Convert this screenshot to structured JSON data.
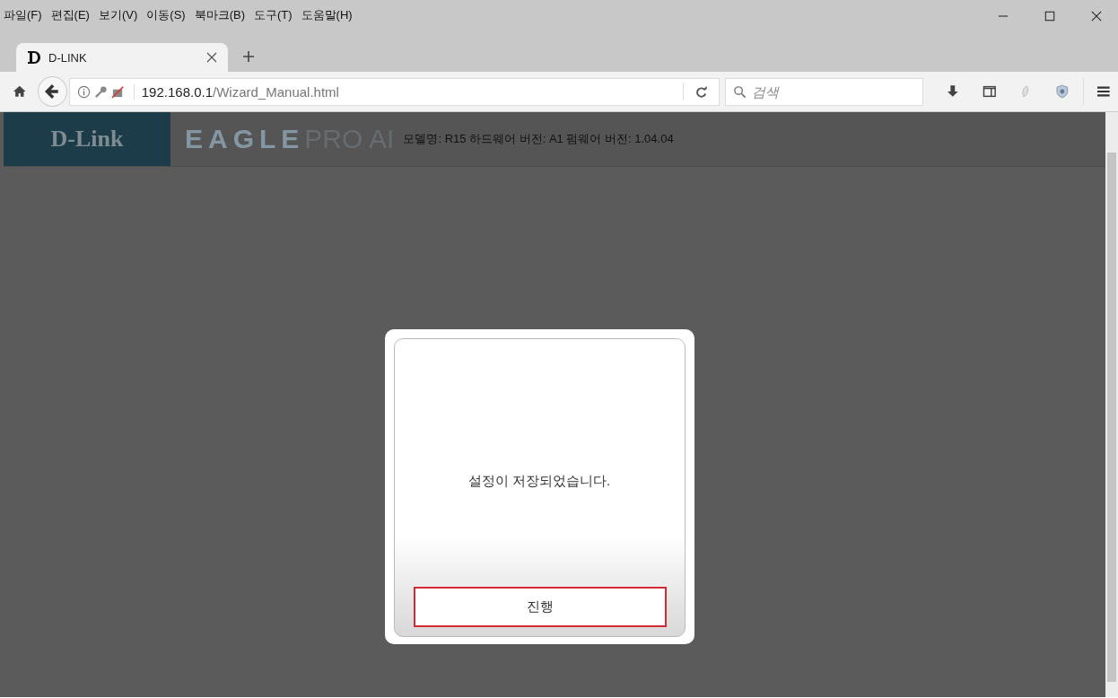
{
  "menu_bar": [
    "파일(F)",
    "편집(E)",
    "보기(V)",
    "이동(S)",
    "북마크(B)",
    "도구(T)",
    "도움말(H)"
  ],
  "tabs": [
    {
      "label": "D-LINK",
      "selected": true
    }
  ],
  "address_bar": {
    "host": "192.168.0.1",
    "path": "/Wizard_Manual.html"
  },
  "search": {
    "placeholder": "검색"
  },
  "page_header": {
    "logo": "D-Link",
    "product": "EAGLE",
    "product_2": "PRO AI",
    "info": "모델명: R15 하드웨어 버전: A1 펌웨어 버전: 1.04.04"
  },
  "dialog": {
    "message": "설정이 저장되었습니다.",
    "button": "진행"
  }
}
